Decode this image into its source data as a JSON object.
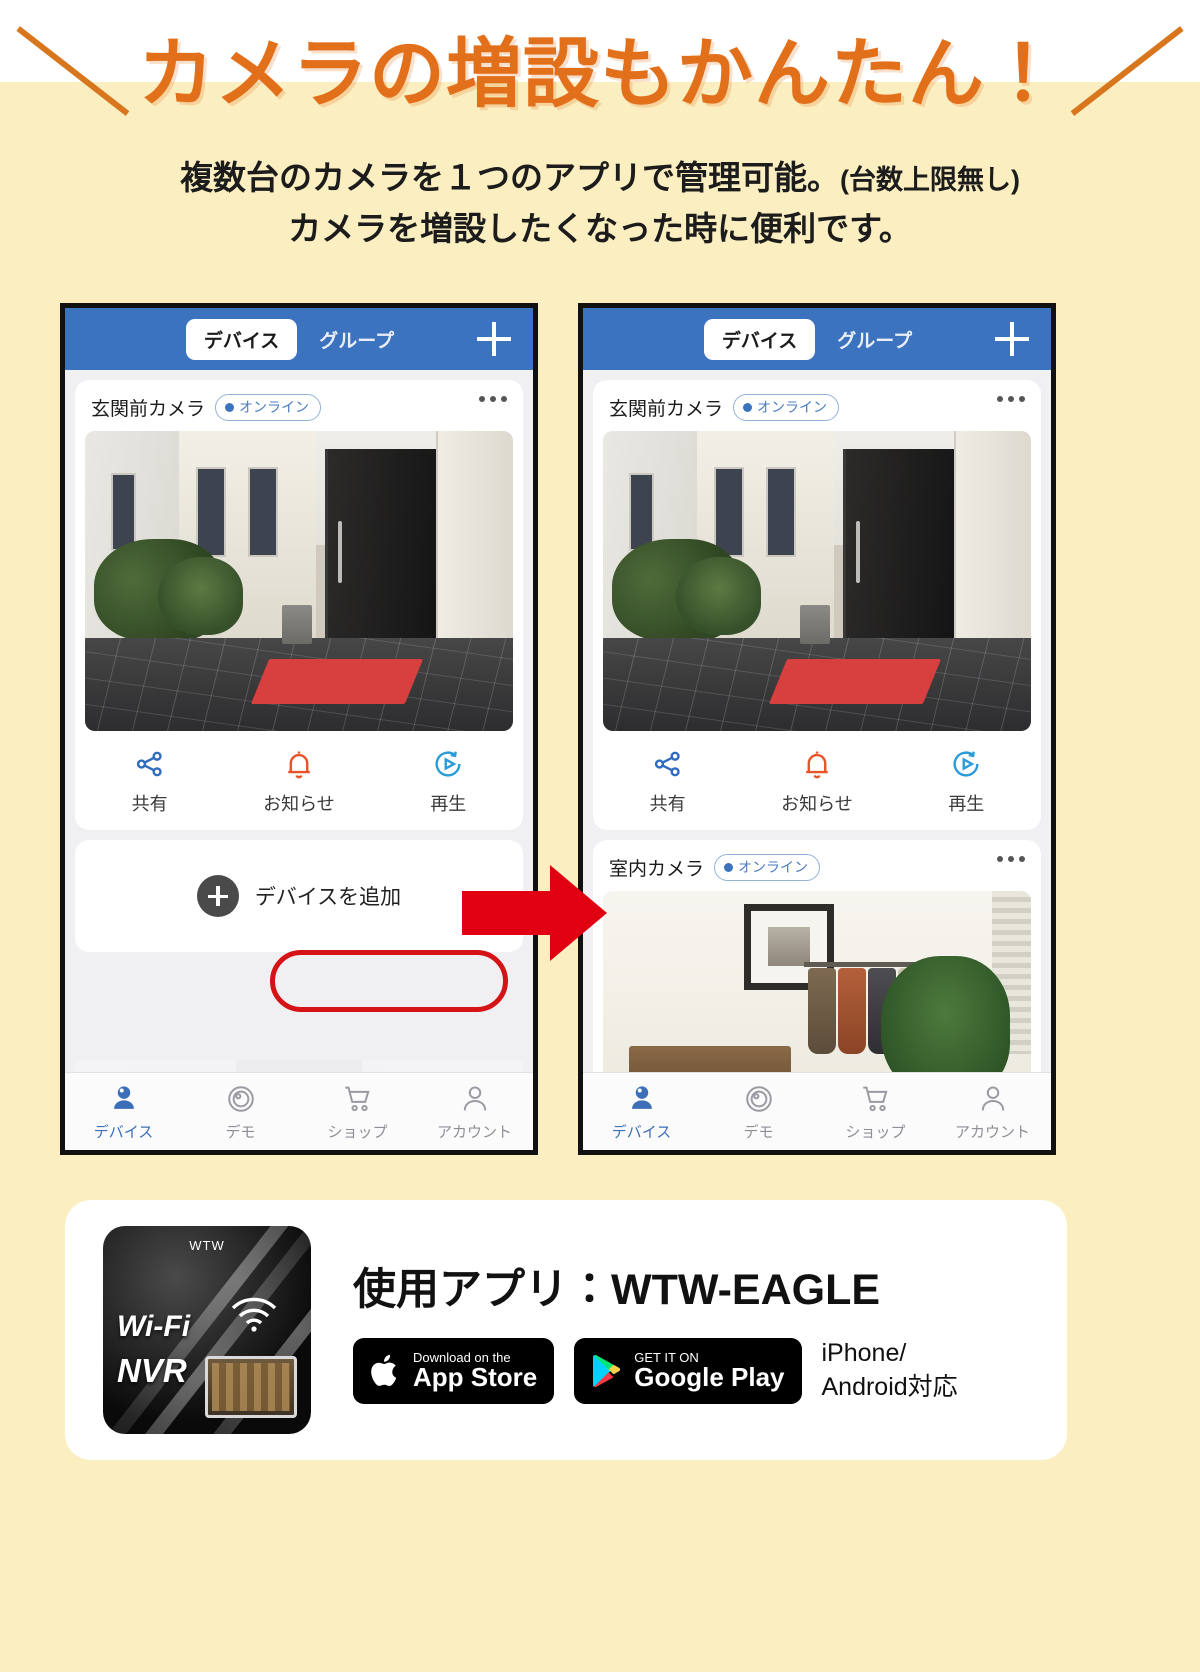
{
  "banner": {
    "title": "カメラの増設もかんたん！",
    "slash_left": "＼",
    "slash_right": "／",
    "subtitle_line1_main": "複数台のカメラを１つのアプリで管理可能。",
    "subtitle_line1_paren": "(台数上限無し)",
    "subtitle_line2": "カメラを増設したくなった時に便利です。",
    "title_color": "#e2701b",
    "bg_color": "#fbeec0"
  },
  "app_ui": {
    "header": {
      "tab_devices": "デバイス",
      "tab_groups": "グループ",
      "add_icon": "plus-icon",
      "bg_color": "#3c73bf"
    },
    "cameras": [
      {
        "name": "玄関前カメラ",
        "status": "オンライン",
        "menu_icon": "more-options-icon"
      },
      {
        "name": "室内カメラ",
        "status": "オンライン",
        "menu_icon": "more-options-icon"
      }
    ],
    "actions": [
      {
        "label": "共有",
        "icon": "share-icon",
        "color": "#2f6bbf"
      },
      {
        "label": "お知らせ",
        "icon": "bell-icon",
        "color": "#e8542a"
      },
      {
        "label": "再生",
        "icon": "replay-icon",
        "color": "#2b9cd8"
      }
    ],
    "add_device": {
      "label": "デバイスを追加",
      "icon": "plus-circle-icon",
      "highlight_color": "#d51317"
    },
    "bottom_nav": [
      {
        "label": "デバイス",
        "icon": "camera-icon",
        "active": true
      },
      {
        "label": "デモ",
        "icon": "demo-icon",
        "active": false
      },
      {
        "label": "ショップ",
        "icon": "cart-icon",
        "active": false
      },
      {
        "label": "アカウント",
        "icon": "account-icon",
        "active": false
      }
    ]
  },
  "arrow": {
    "name": "right-arrow",
    "color": "#e00012"
  },
  "app_card": {
    "icon": {
      "name": "wtw-eagle-app-icon",
      "brand": "WTW",
      "wifi_text": "Wi-Fi",
      "nvr_text": "NVR"
    },
    "title": "使用アプリ：WTW-EAGLE",
    "badges": [
      {
        "name": "app-store-badge",
        "small": "Download on the",
        "big": "App Store",
        "icon": "apple-icon"
      },
      {
        "name": "google-play-badge",
        "small": "GET IT ON",
        "big": "Google Play",
        "icon": "play-triangle-icon"
      }
    ],
    "os_note_line1": "iPhone/",
    "os_note_line2": "Android対応"
  }
}
